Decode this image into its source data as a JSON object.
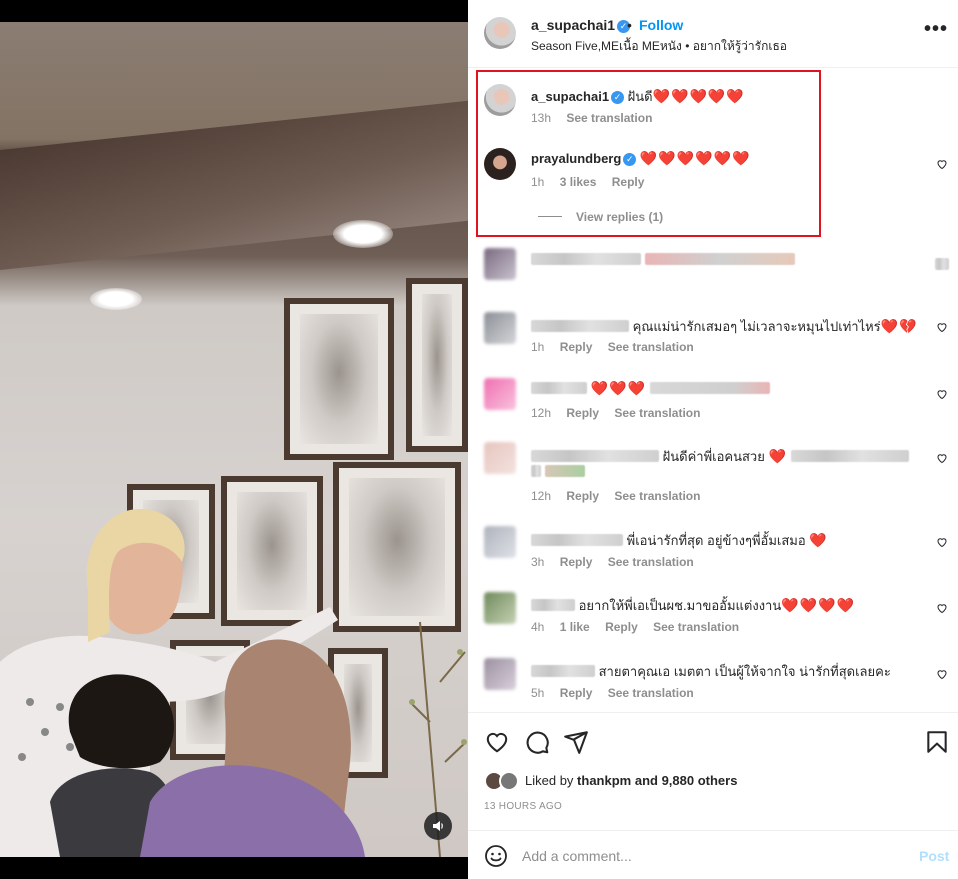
{
  "post": {
    "username": "a_supachai1",
    "follow_label": "Follow",
    "dot": "•",
    "subtitle": "Season Five,MEเนื้อ MEหนัง • อยากให้รู้ว่ารักเธอ",
    "more_label": "•••"
  },
  "comments": [
    {
      "username": "a_supachai1",
      "text": "ฝันดี",
      "hearts": "❤️❤️❤️❤️❤️",
      "time": "13h",
      "actions": [
        "See translation"
      ]
    },
    {
      "username": "prayalundberg",
      "text": "",
      "hearts": "❤️❤️❤️❤️❤️❤️",
      "time": "1h",
      "likes": "3 likes",
      "actions": [
        "Reply"
      ],
      "view_replies": "View replies (1)"
    },
    {
      "blurred": true
    },
    {
      "text": "คุณแม่น่ารักเสมอๆ ไม่เวลาจะหมุนไปเท่าไหร่",
      "hearts": "❤️💔",
      "time": "1h",
      "actions": [
        "Reply",
        "See translation"
      ]
    },
    {
      "text": "",
      "hearts": "❤️❤️❤️",
      "time": "12h",
      "actions": [
        "Reply",
        "See translation"
      ]
    },
    {
      "text": "ฝันดีค่าพี่เอคนสวย",
      "hearts": "❤️",
      "time": "12h",
      "actions": [
        "Reply",
        "See translation"
      ]
    },
    {
      "text": "พี่เอน่ารักที่สุด อยู่ข้างๆพี่อั้มเสมอ",
      "hearts": "❤️",
      "time": "3h",
      "actions": [
        "Reply",
        "See translation"
      ]
    },
    {
      "text": "อยากให้พี่เอเป็นผช.มาขออั้มแต่งงาน",
      "hearts": "❤️❤️❤️❤️",
      "time": "4h",
      "likes": "1 like",
      "actions": [
        "Reply",
        "See translation"
      ]
    },
    {
      "text": "สายตาคุณเอ เมตตา เป็นผู้ให้จากใจ น่ารักที่สุดเลยคะ",
      "hearts": "",
      "time": "5h",
      "actions": [
        "Reply",
        "See translation"
      ]
    }
  ],
  "likes": {
    "prefix": "Liked by",
    "user": "thankpm",
    "suffix": "and 9,880 others"
  },
  "timestamp": "13 HOURS AGO",
  "composer": {
    "placeholder": "Add a comment...",
    "post_label": "Post"
  },
  "colors": {
    "accent": "#0095f6",
    "highlight_box": "#e0141e",
    "heart": "#d4143a"
  }
}
